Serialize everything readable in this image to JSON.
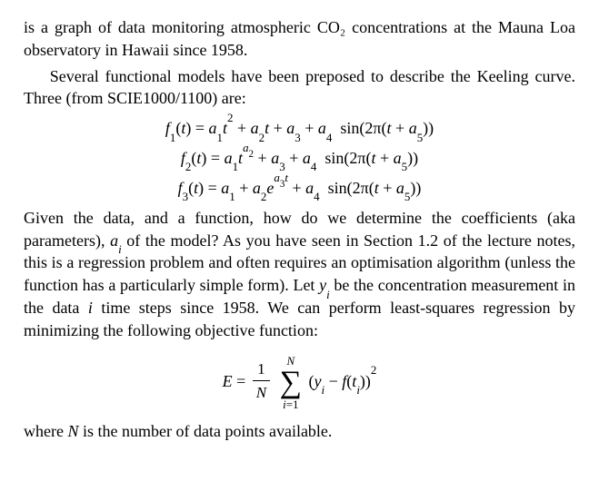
{
  "para1": "is a graph of data monitoring atmospheric CO₂ concentrations at the Mauna Loa observatory in Hawaii since 1958.",
  "para2": "Several functional models have been preposed to describe the Keeling curve. Three (from SCIE1000/1100) are:",
  "eq1": {
    "lhs_f": "f",
    "lhs_sub": "1",
    "lhs_arg": "t",
    "a1": "a",
    "a1s": "1",
    "pow1": "2",
    "a2": "a",
    "a2s": "2",
    "a3": "a",
    "a3s": "3",
    "a4": "a",
    "a4s": "4",
    "sinfn": "sin",
    "twopi": "2π",
    "a5": "a",
    "a5s": "5"
  },
  "eq2": {
    "lhs_f": "f",
    "lhs_sub": "2",
    "lhs_arg": "t",
    "a1": "a",
    "a1s": "1",
    "expv": "a",
    "exps": "2",
    "a3": "a",
    "a3s": "3",
    "a4": "a",
    "a4s": "4",
    "sinfn": "sin",
    "twopi": "2π",
    "a5": "a",
    "a5s": "5"
  },
  "eq3": {
    "lhs_f": "f",
    "lhs_sub": "3",
    "lhs_arg": "t",
    "a1": "a",
    "a1s": "1",
    "a2": "a",
    "a2s": "2",
    "ebase": "e",
    "eexp_a": "a",
    "eexp_s": "3",
    "eexp_t": "t",
    "a4": "a",
    "a4s": "4",
    "sinfn": "sin",
    "twopi": "2π",
    "a5": "a",
    "a5s": "5"
  },
  "para3a": "Given the data, and a function, how do we determine the coefficients (aka parameters), ",
  "para3_ai_a": "a",
  "para3_ai_i": "i",
  "para3b": " of the model? As you have seen in Section 1.2 of the lecture notes, this is a regression problem and often requires an optimisation algorithm (unless the function has a particularly simple form). Let ",
  "para3_yi_y": "y",
  "para3_yi_i": "i",
  "para3c": " be the concentration measurement in the data ",
  "para3_i": "i",
  "para3d": " time steps since 1958. We can perform least-squares regression by minimizing the following objective function:",
  "eqE": {
    "E": "E",
    "frac_num": "1",
    "frac_den": "N",
    "sum_top": "N",
    "sum_bot_i": "i",
    "sum_bot_eq": "=1",
    "yi_y": "y",
    "yi_i": "i",
    "f": "f",
    "t": "t",
    "ti": "i",
    "sq": "2"
  },
  "para4a": "where ",
  "para4_N": "N",
  "para4b": " is the number of data points available."
}
